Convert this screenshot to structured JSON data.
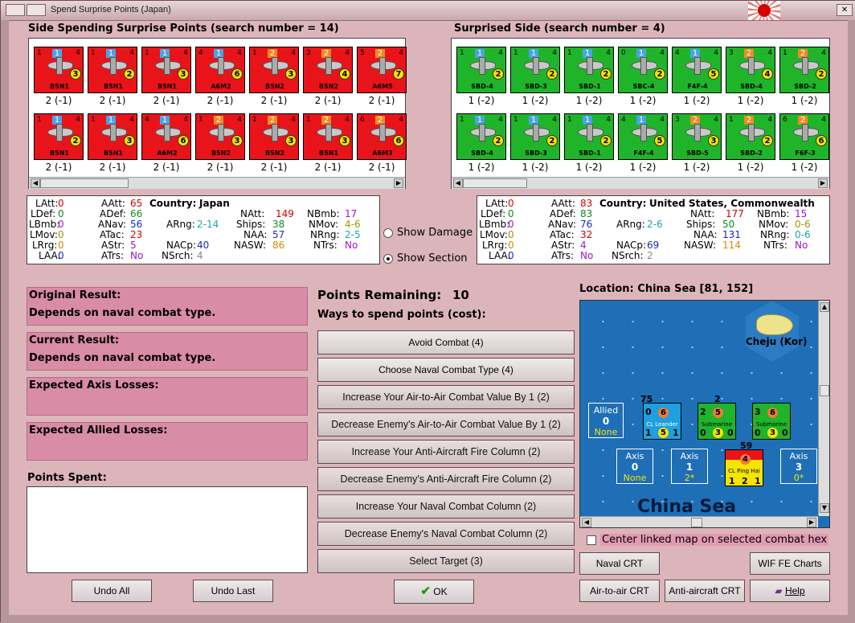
{
  "window": {
    "title": "Spend Surprise Points (Japan)"
  },
  "left_side": {
    "title": "Side Spending Surprise Points (search number = 14)",
    "row1": [
      {
        "name": "B5N1",
        "top": "1",
        "top_color": "blue",
        "circle": "3",
        "l": "1",
        "r": "4",
        "value": "2 (-1)"
      },
      {
        "name": "B5N1",
        "top": "1",
        "top_color": "blue",
        "circle": "2",
        "l": "1",
        "r": "4",
        "value": "2 (-1)"
      },
      {
        "name": "B5N1",
        "top": "1",
        "top_color": "blue",
        "circle": "3",
        "l": "1",
        "r": "4",
        "value": "2 (-1)"
      },
      {
        "name": "A6M2",
        "top": "1",
        "top_color": "blue",
        "circle": "6",
        "l": "4",
        "r": "4",
        "value": "2 (-1)"
      },
      {
        "name": "B5N2",
        "top": "2",
        "top_color": "orange",
        "circle": "3",
        "l": "1",
        "r": "4",
        "value": "2 (-1)"
      },
      {
        "name": "B5N2",
        "top": "2",
        "top_color": "orange",
        "circle": "4",
        "l": "3",
        "r": "4",
        "value": "2 (-1)"
      },
      {
        "name": "A6M5",
        "top": "2",
        "top_color": "orange",
        "circle": "7",
        "l": "5",
        "r": "4",
        "value": "2 (-1)"
      }
    ],
    "row2": [
      {
        "name": "B5N1",
        "top": "1",
        "top_color": "blue",
        "circle": "2",
        "l": "1",
        "r": "4",
        "value": "2 (-1)"
      },
      {
        "name": "B5N1",
        "top": "1",
        "top_color": "blue",
        "circle": "3",
        "l": "1",
        "r": "4",
        "value": "2 (-1)"
      },
      {
        "name": "A6M2",
        "top": "1",
        "top_color": "blue",
        "circle": "6",
        "l": "4",
        "r": "4",
        "value": "2 (-1)"
      },
      {
        "name": "B5N2",
        "top": "2",
        "top_color": "orange",
        "circle": "3",
        "l": "1",
        "r": "4",
        "value": "2 (-1)"
      },
      {
        "name": "B5N2",
        "top": "2",
        "top_color": "orange",
        "circle": "3",
        "l": "1",
        "r": "4",
        "value": "2 (-1)"
      },
      {
        "name": "B5N1",
        "top": "2",
        "top_color": "orange",
        "circle": "3",
        "l": "1",
        "r": "4",
        "value": "2 (-1)"
      },
      {
        "name": "A6M3",
        "top": "2",
        "top_color": "orange",
        "circle": "6",
        "l": "6",
        "r": "4",
        "value": "2 (-1)"
      }
    ]
  },
  "right_side": {
    "title": "Surprised Side (search number = 4)",
    "row1": [
      {
        "name": "SBD-4",
        "top": "1",
        "top_color": "blue",
        "circle": "2",
        "l": "1",
        "r": "4",
        "value": "1 (-2)"
      },
      {
        "name": "SBD-3",
        "top": "1",
        "top_color": "blue",
        "circle": "2",
        "l": "1",
        "r": "4",
        "value": "1 (-2)"
      },
      {
        "name": "SBD-1",
        "top": "1",
        "top_color": "blue",
        "circle": "2",
        "l": "1",
        "r": "4",
        "value": "1 (-2)"
      },
      {
        "name": "SBC-4",
        "top": "1",
        "top_color": "blue",
        "circle": "2",
        "l": "0",
        "r": "4",
        "value": "1 (-2)"
      },
      {
        "name": "F4F-4",
        "top": "1",
        "top_color": "blue",
        "circle": "5",
        "l": "4",
        "r": "4",
        "value": "1 (-2)"
      },
      {
        "name": "SBD-4",
        "top": "2",
        "top_color": "orange",
        "circle": "4",
        "l": "3",
        "r": "4",
        "value": "1 (-2)"
      },
      {
        "name": "SBD-2",
        "top": "2",
        "top_color": "orange",
        "circle": "2",
        "l": "1",
        "r": "4",
        "value": "1 (-2)"
      }
    ],
    "row2": [
      {
        "name": "SBD-4",
        "top": "1",
        "top_color": "blue",
        "circle": "2",
        "l": "1",
        "r": "4",
        "value": "1 (-2)"
      },
      {
        "name": "SBD-3",
        "top": "1",
        "top_color": "blue",
        "circle": "2",
        "l": "1",
        "r": "4",
        "value": "1 (-2)"
      },
      {
        "name": "SBD-1",
        "top": "1",
        "top_color": "blue",
        "circle": "2",
        "l": "1",
        "r": "4",
        "value": "1 (-2)"
      },
      {
        "name": "F4F-4",
        "top": "1",
        "top_color": "blue",
        "circle": "5",
        "l": "4",
        "r": "4",
        "value": "1 (-2)"
      },
      {
        "name": "SBD-5",
        "top": "2",
        "top_color": "orange",
        "circle": "3",
        "l": "3",
        "r": "4",
        "value": "1 (-2)"
      },
      {
        "name": "SBD-2",
        "top": "2",
        "top_color": "orange",
        "circle": "2",
        "l": "1",
        "r": "4",
        "value": "1 (-2)"
      },
      {
        "name": "F6F-3",
        "top": "2",
        "top_color": "orange",
        "circle": "6",
        "l": "6",
        "r": "4",
        "value": "1 (-2)"
      }
    ]
  },
  "stats_left": {
    "country_label": "Country:",
    "country": "Japan",
    "LAtt": "0",
    "LDef": "0",
    "LBmb": "0",
    "LMov": "0",
    "LRrg": "0",
    "LAA": "0",
    "AAtt": "65",
    "ADef": "66",
    "ANav": "56",
    "ATac": "23",
    "AStr": "5",
    "ATrs": "No",
    "ARng": "2-14",
    "NACp": "40",
    "NSrch": "4",
    "NAtt": "149",
    "Ships": "38",
    "NAA": "57",
    "NASW": "86",
    "NBmb": "17",
    "NMov": "4-6",
    "NRng": "2-5",
    "NTrs": "No"
  },
  "stats_right": {
    "country_label": "Country:",
    "country": "United States, Commonwealth",
    "LAtt": "0",
    "LDef": "0",
    "LBmb": "0",
    "LMov": "0",
    "LRrg": "0",
    "LAA": "0",
    "AAtt": "83",
    "ADef": "83",
    "ANav": "76",
    "ATac": "32",
    "AStr": "4",
    "ATrs": "No",
    "ARng": "2-6",
    "NACp": "69",
    "NSrch": "2",
    "NAtt": "177",
    "Ships": "50",
    "NAA": "131",
    "NASW": "114",
    "NBmb": "15",
    "NMov": "0-6",
    "NRng": "0-6",
    "NTrs": "No"
  },
  "options": {
    "show_damage": "Show Damage",
    "show_section": "Show Section"
  },
  "results": {
    "original_label": "Original Result:",
    "original_value": "Depends on naval combat type.",
    "current_label": "Current Result:",
    "current_value": "Depends on naval combat type.",
    "axis_losses": "Expected Axis Losses:",
    "allied_losses": "Expected Allied Losses:",
    "points_spent": "Points Spent:"
  },
  "points": {
    "label": "Points Remaining:",
    "value": "10",
    "ways": "Ways to spend points (cost):"
  },
  "actions": [
    "Avoid Combat (4)",
    "Choose Naval Combat Type (4)",
    "Increase Your Air-to-Air Combat Value By 1 (2)",
    "Decrease Enemy's Air-to-Air Combat Value By 1 (2)",
    "Increase Your Anti-Aircraft Fire Column (2)",
    "Decrease Enemy's Anti-Aircraft Fire Column (2)",
    "Increase Your Naval Combat Column (2)",
    "Decrease Enemy's Naval Combat Column (2)",
    "Select Target (3)"
  ],
  "map": {
    "location": "Location: China Sea [81, 152]",
    "place": "Cheju (Kor)",
    "sea": "China Sea",
    "allied_box": {
      "title": "Allied",
      "num": "0",
      "sub": "None"
    },
    "axis_boxes": [
      {
        "title": "Axis",
        "num": "0",
        "sub": "None"
      },
      {
        "title": "Axis",
        "num": "1",
        "sub": "2*"
      },
      {
        "title": "Axis",
        "num": "3",
        "sub": "0*"
      }
    ],
    "ships": [
      {
        "label": "CL Leander",
        "stack": "75",
        "n1": "0",
        "n2": "6",
        "n3": "1",
        "n4": "5",
        "n5": "1",
        "nat": "NZL"
      },
      {
        "label": "Submarine",
        "stack": "2",
        "n1": "2",
        "n2": "5",
        "n3": "0",
        "n4": "3",
        "n5": "0"
      },
      {
        "label": "Submarine",
        "stack": "",
        "n1": "3",
        "n2": "6",
        "n3": "0",
        "n4": "3",
        "n5": "0"
      },
      {
        "label": "CL Ping Hai",
        "stack": "59",
        "n1": "",
        "n2": "4",
        "n3": "1",
        "n4": "2",
        "n5": "1"
      }
    ]
  },
  "center_linked": "Center linked map on selected combat hex",
  "buttons": {
    "undo_all": "Undo All",
    "undo_last": "Undo Last",
    "ok": "OK",
    "naval_crt": "Naval CRT",
    "wif_charts": "WIF FE Charts",
    "air_crt": "Air-to-air CRT",
    "aa_crt": "Anti-aircraft CRT",
    "help": "Help"
  }
}
